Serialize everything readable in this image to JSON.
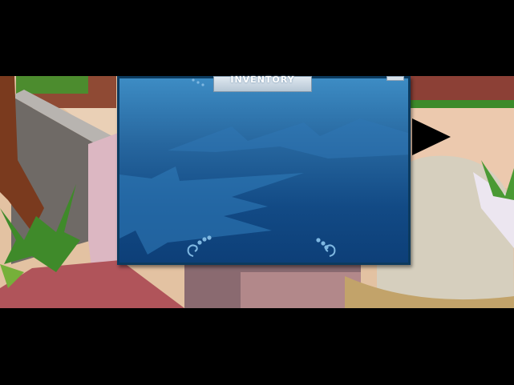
{
  "inventory": {
    "title": "INVENTORY"
  },
  "colors": {
    "panel_top": "#3d8cc4",
    "panel_bottom": "#0d3f78",
    "panel_border": "#0c3a5e",
    "sand": "#e8c8a8",
    "foliage": "#3f8a2a"
  },
  "icons": [
    "next-arrow-icon",
    "close-icon",
    "swirl-icon"
  ]
}
